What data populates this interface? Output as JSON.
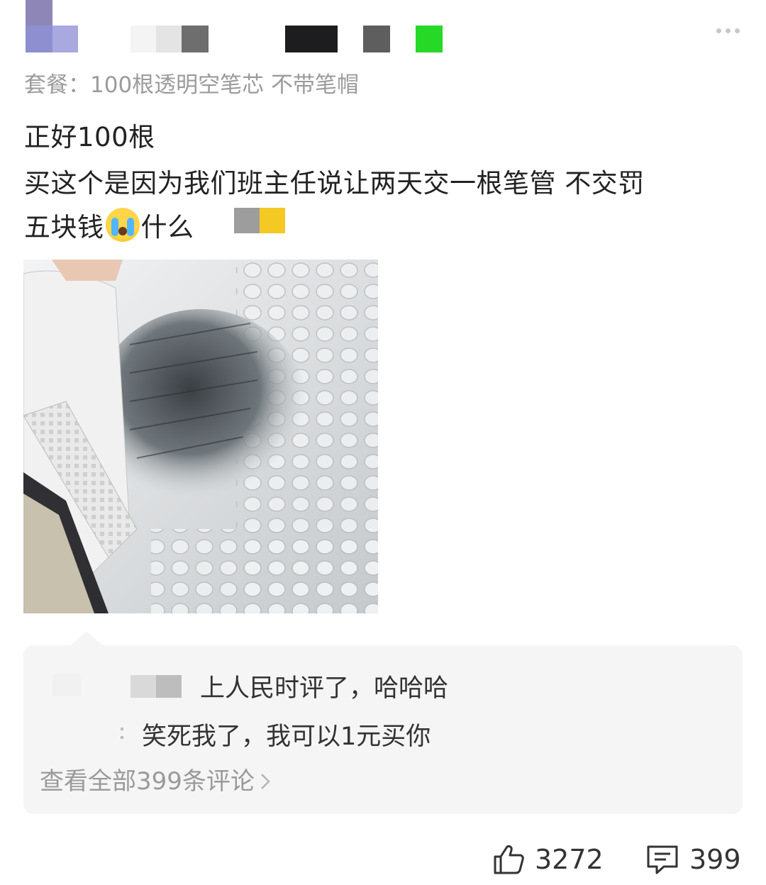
{
  "post": {
    "package_line": "套餐：100根透明空笔芯 不带笔帽",
    "text_line_1": "正好100根",
    "text_line_2": "买这个是因为我们班主任说让两天交一根笔管 不交罚",
    "text_line_3a": "五块钱",
    "text_line_3b": "什么",
    "photo_description": "photo-of-clear-pen-refills-in-bubble-wrap"
  },
  "comments": {
    "items": [
      {
        "text": "上人民时评了，哈哈哈"
      },
      {
        "text": "笑死我了，我可以1元买你"
      }
    ],
    "view_all": "查看全部399条评论"
  },
  "footer": {
    "likes": "3272",
    "comments": "399"
  },
  "icons": {
    "more": "more-icon",
    "emoji": "crying-face-emoji",
    "like": "thumbs-up-icon",
    "comment": "comment-icon",
    "chevron": "chevron-right-icon"
  },
  "colors": {
    "green_block": "#27d927",
    "yellow_block": "#f5c924",
    "comment_bg": "#f5f5f5",
    "meta_text": "#9b9b9b"
  }
}
